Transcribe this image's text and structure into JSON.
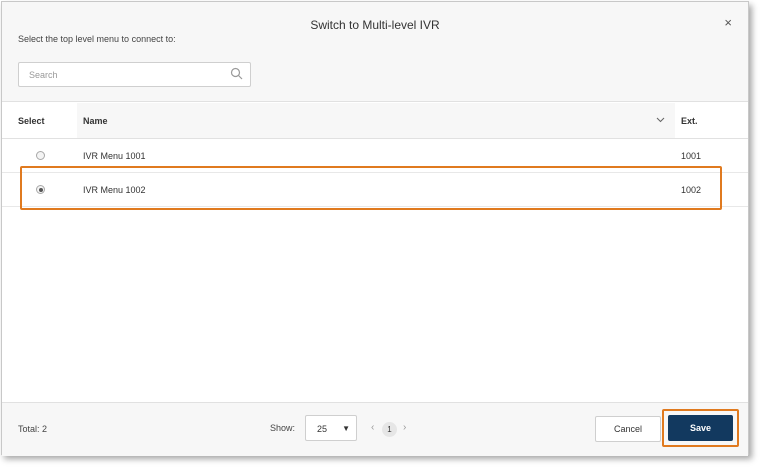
{
  "dialog": {
    "title": "Switch to Multi-level IVR",
    "close_glyph": "×",
    "prompt": "Select the top level menu to connect to:"
  },
  "search": {
    "placeholder": "Search",
    "icon": "search-icon"
  },
  "table": {
    "columns": {
      "select": "Select",
      "name": "Name",
      "ext": "Ext."
    },
    "rows": [
      {
        "name": "IVR Menu 1001",
        "ext": "1001",
        "selected": false
      },
      {
        "name": "IVR Menu 1002",
        "ext": "1002",
        "selected": true
      }
    ]
  },
  "footer": {
    "total": "Total: 2",
    "show_label": "Show:",
    "page_size": "25",
    "page_current": "1",
    "prev_glyph": "‹",
    "next_glyph": "›",
    "cancel_label": "Cancel",
    "save_label": "Save"
  },
  "colors": {
    "accent_outline": "#e07a1f",
    "primary_button": "#12395f"
  }
}
